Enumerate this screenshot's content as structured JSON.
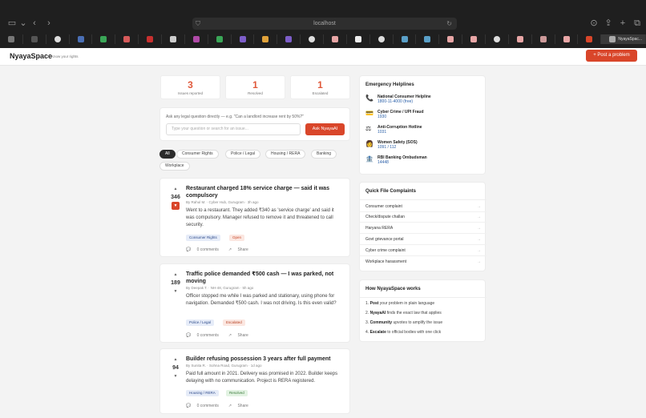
{
  "browser": {
    "url": "localhost",
    "active_tab_title": "NyayaSpac..."
  },
  "header": {
    "brand": "NyayaSpace",
    "tagline": "Know your rights",
    "post_button": "+ Post a problem"
  },
  "stats": [
    {
      "value": "3",
      "label": "Issues reported"
    },
    {
      "value": "1",
      "label": "Resolved"
    },
    {
      "value": "1",
      "label": "Escalated"
    }
  ],
  "ask": {
    "hint": "Ask any legal question directly — e.g. \"Can a landlord increase rent by 50%?\"",
    "placeholder": "Type your question or search for an issue...",
    "button": "Ask NyayaAI"
  },
  "filters": [
    "All",
    "Consumer Rights",
    "Police / Legal",
    "Housing / RERA",
    "Banking",
    "Workplace"
  ],
  "posts": [
    {
      "title": "Restaurant charged 18% service charge — said it was compulsory",
      "votes": "346",
      "author": "By Rahul M.",
      "location": "Cyber Hub, Gurugram",
      "time": "3h ago",
      "body": "Went to a restaurant. They added ₹340 as 'service charge' and said it was compulsory. Manager refused to remove it and threatened to call security.",
      "category": "Consumer Rights",
      "status": "Open",
      "comments": "0 comments",
      "share": "Share"
    },
    {
      "title": "Traffic police demanded ₹500 cash — I was parked, not moving",
      "votes": "189",
      "author": "By Deepak T.",
      "location": "NH-48, Gurugram",
      "time": "5h ago",
      "body": "Officer stopped me while I was parked and stationary, using phone for navigation. Demanded ₹500 cash. I was not driving. Is this even valid?",
      "category": "Police / Legal",
      "status": "Escalated",
      "comments": "0 comments",
      "share": "Share"
    },
    {
      "title": "Builder refusing possession 3 years after full payment",
      "votes": "94",
      "author": "By Sunita R.",
      "location": "Sohna Road, Gurugram",
      "time": "1d ago",
      "body": "Paid full amount in 2021. Delivery was promised in 2022. Builder keeps delaying with no communication. Project is RERA registered.",
      "category": "Housing / RERA",
      "status": "Resolved",
      "comments": "0 comments",
      "share": "Share"
    }
  ],
  "helplines": {
    "title": "Emergency Helplines",
    "items": [
      {
        "icon": "phone-icon",
        "name": "National Consumer Helpline",
        "number": "1800-11-4000 (free)"
      },
      {
        "icon": "card-icon",
        "name": "Cyber Crime / UPI Fraud",
        "number": "1930"
      },
      {
        "icon": "scales-icon",
        "name": "Anti-Corruption Hotline",
        "number": "1031"
      },
      {
        "icon": "woman-icon",
        "name": "Women Safety (SOS)",
        "number": "1091 / 112"
      },
      {
        "icon": "bank-icon",
        "name": "RBI Banking Ombudsman",
        "number": "14448"
      }
    ]
  },
  "quick_file": {
    "title": "Quick File Complaints",
    "items": [
      "Consumer complaint",
      "Check/dispute challan",
      "Haryana RERA",
      "Govt grievance portal",
      "Cyber crime complaint",
      "Workplace harassment"
    ]
  },
  "how_it_works": {
    "title": "How NyayaSpace works",
    "steps": [
      {
        "num": "1.",
        "bold": "Post",
        "text": "your problem in plain language"
      },
      {
        "num": "2.",
        "bold": "NyayaAI",
        "text": "finds the exact law that applies"
      },
      {
        "num": "3.",
        "bold": "Community",
        "text": "upvotes to amplify the issue"
      },
      {
        "num": "4.",
        "bold": "Escalate",
        "text": "to official bodies with one click"
      }
    ]
  },
  "colors": {
    "accent": "#d9462a",
    "stat_number": "#e0593b",
    "link": "#2a5fa8"
  }
}
